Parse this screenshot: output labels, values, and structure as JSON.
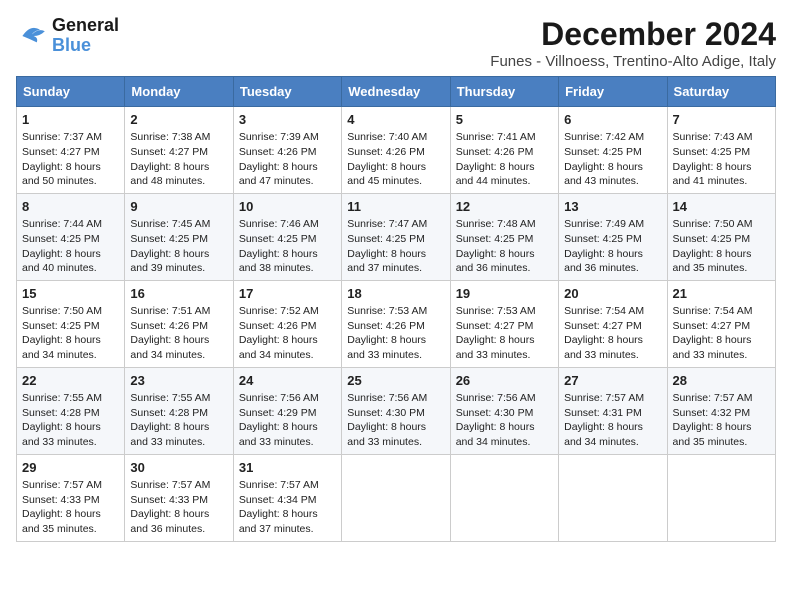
{
  "logo": {
    "line1": "General",
    "line2": "Blue"
  },
  "title": "December 2024",
  "subtitle": "Funes - Villnoess, Trentino-Alto Adige, Italy",
  "days_header": [
    "Sunday",
    "Monday",
    "Tuesday",
    "Wednesday",
    "Thursday",
    "Friday",
    "Saturday"
  ],
  "weeks": [
    [
      {
        "day": "1",
        "info": "Sunrise: 7:37 AM\nSunset: 4:27 PM\nDaylight: 8 hours\nand 50 minutes."
      },
      {
        "day": "2",
        "info": "Sunrise: 7:38 AM\nSunset: 4:27 PM\nDaylight: 8 hours\nand 48 minutes."
      },
      {
        "day": "3",
        "info": "Sunrise: 7:39 AM\nSunset: 4:26 PM\nDaylight: 8 hours\nand 47 minutes."
      },
      {
        "day": "4",
        "info": "Sunrise: 7:40 AM\nSunset: 4:26 PM\nDaylight: 8 hours\nand 45 minutes."
      },
      {
        "day": "5",
        "info": "Sunrise: 7:41 AM\nSunset: 4:26 PM\nDaylight: 8 hours\nand 44 minutes."
      },
      {
        "day": "6",
        "info": "Sunrise: 7:42 AM\nSunset: 4:25 PM\nDaylight: 8 hours\nand 43 minutes."
      },
      {
        "day": "7",
        "info": "Sunrise: 7:43 AM\nSunset: 4:25 PM\nDaylight: 8 hours\nand 41 minutes."
      }
    ],
    [
      {
        "day": "8",
        "info": "Sunrise: 7:44 AM\nSunset: 4:25 PM\nDaylight: 8 hours\nand 40 minutes."
      },
      {
        "day": "9",
        "info": "Sunrise: 7:45 AM\nSunset: 4:25 PM\nDaylight: 8 hours\nand 39 minutes."
      },
      {
        "day": "10",
        "info": "Sunrise: 7:46 AM\nSunset: 4:25 PM\nDaylight: 8 hours\nand 38 minutes."
      },
      {
        "day": "11",
        "info": "Sunrise: 7:47 AM\nSunset: 4:25 PM\nDaylight: 8 hours\nand 37 minutes."
      },
      {
        "day": "12",
        "info": "Sunrise: 7:48 AM\nSunset: 4:25 PM\nDaylight: 8 hours\nand 36 minutes."
      },
      {
        "day": "13",
        "info": "Sunrise: 7:49 AM\nSunset: 4:25 PM\nDaylight: 8 hours\nand 36 minutes."
      },
      {
        "day": "14",
        "info": "Sunrise: 7:50 AM\nSunset: 4:25 PM\nDaylight: 8 hours\nand 35 minutes."
      }
    ],
    [
      {
        "day": "15",
        "info": "Sunrise: 7:50 AM\nSunset: 4:25 PM\nDaylight: 8 hours\nand 34 minutes."
      },
      {
        "day": "16",
        "info": "Sunrise: 7:51 AM\nSunset: 4:26 PM\nDaylight: 8 hours\nand 34 minutes."
      },
      {
        "day": "17",
        "info": "Sunrise: 7:52 AM\nSunset: 4:26 PM\nDaylight: 8 hours\nand 34 minutes."
      },
      {
        "day": "18",
        "info": "Sunrise: 7:53 AM\nSunset: 4:26 PM\nDaylight: 8 hours\nand 33 minutes."
      },
      {
        "day": "19",
        "info": "Sunrise: 7:53 AM\nSunset: 4:27 PM\nDaylight: 8 hours\nand 33 minutes."
      },
      {
        "day": "20",
        "info": "Sunrise: 7:54 AM\nSunset: 4:27 PM\nDaylight: 8 hours\nand 33 minutes."
      },
      {
        "day": "21",
        "info": "Sunrise: 7:54 AM\nSunset: 4:27 PM\nDaylight: 8 hours\nand 33 minutes."
      }
    ],
    [
      {
        "day": "22",
        "info": "Sunrise: 7:55 AM\nSunset: 4:28 PM\nDaylight: 8 hours\nand 33 minutes."
      },
      {
        "day": "23",
        "info": "Sunrise: 7:55 AM\nSunset: 4:28 PM\nDaylight: 8 hours\nand 33 minutes."
      },
      {
        "day": "24",
        "info": "Sunrise: 7:56 AM\nSunset: 4:29 PM\nDaylight: 8 hours\nand 33 minutes."
      },
      {
        "day": "25",
        "info": "Sunrise: 7:56 AM\nSunset: 4:30 PM\nDaylight: 8 hours\nand 33 minutes."
      },
      {
        "day": "26",
        "info": "Sunrise: 7:56 AM\nSunset: 4:30 PM\nDaylight: 8 hours\nand 34 minutes."
      },
      {
        "day": "27",
        "info": "Sunrise: 7:57 AM\nSunset: 4:31 PM\nDaylight: 8 hours\nand 34 minutes."
      },
      {
        "day": "28",
        "info": "Sunrise: 7:57 AM\nSunset: 4:32 PM\nDaylight: 8 hours\nand 35 minutes."
      }
    ],
    [
      {
        "day": "29",
        "info": "Sunrise: 7:57 AM\nSunset: 4:33 PM\nDaylight: 8 hours\nand 35 minutes."
      },
      {
        "day": "30",
        "info": "Sunrise: 7:57 AM\nSunset: 4:33 PM\nDaylight: 8 hours\nand 36 minutes."
      },
      {
        "day": "31",
        "info": "Sunrise: 7:57 AM\nSunset: 4:34 PM\nDaylight: 8 hours\nand 37 minutes."
      },
      null,
      null,
      null,
      null
    ]
  ]
}
